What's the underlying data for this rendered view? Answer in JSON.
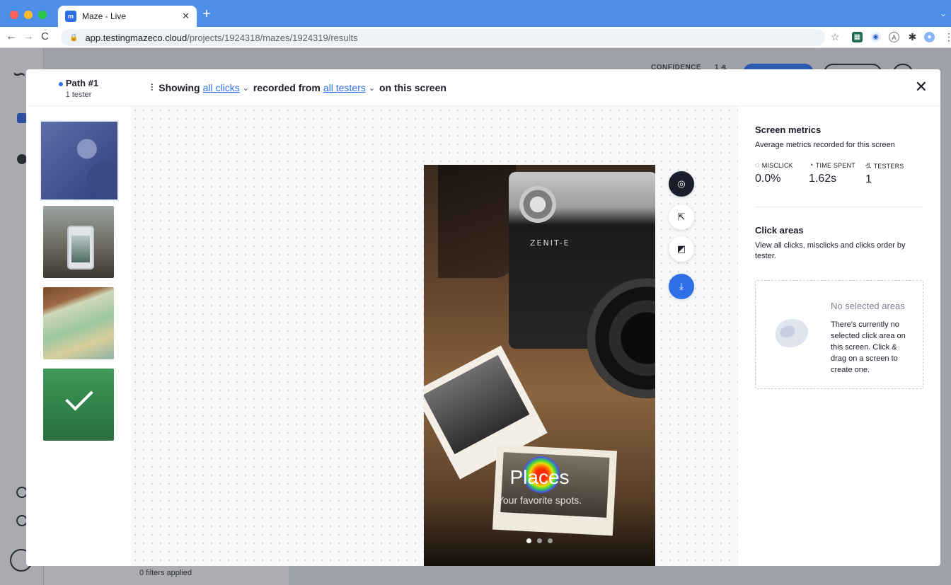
{
  "browser": {
    "tab_title": "Maze - Live",
    "tab_favicon": "m",
    "url_host": "app.testingmazeco.cloud",
    "url_path": "/projects/1924318/mazes/1924319/results"
  },
  "app": {
    "confidence_label": "CONFIDENCE",
    "confidence_value": "1 ዷ",
    "filters_applied": "0 filters applied"
  },
  "modal": {
    "path": {
      "name": "Path #1",
      "testers": "1 tester"
    },
    "header": {
      "showing": "Showing",
      "clicks_link": "all clicks",
      "recorded_from": "recorded from",
      "testers_link": "all testers",
      "suffix": "on this screen"
    },
    "screen": {
      "camera_brand": "ZENIT-E",
      "title": "Places",
      "subtitle": "Your favorite spots."
    },
    "tools": [
      "heatmap-icon",
      "cursor-icon",
      "area-select-icon",
      "download-icon"
    ],
    "metrics": {
      "title": "Screen metrics",
      "description": "Average metrics recorded for this screen",
      "items": [
        {
          "label": "MISCLICK",
          "value": "0.0%",
          "icon": "misclick-icon"
        },
        {
          "label": "TIME SPENT",
          "value": "1.62s",
          "icon": "clock-icon"
        },
        {
          "label": "TESTERS",
          "value": "1",
          "icon": "testers-icon"
        }
      ]
    },
    "click_areas": {
      "title": "Click areas",
      "description": "View all clicks, misclicks and clicks order by tester.",
      "empty_title": "No selected areas",
      "empty_text": "There's currently no selected click area on this screen. Click & drag on a screen to create one."
    }
  },
  "colors": {
    "accent": "#2e6fe6",
    "text": "#1b1d2a",
    "tabbar": "#4d8fe8"
  }
}
